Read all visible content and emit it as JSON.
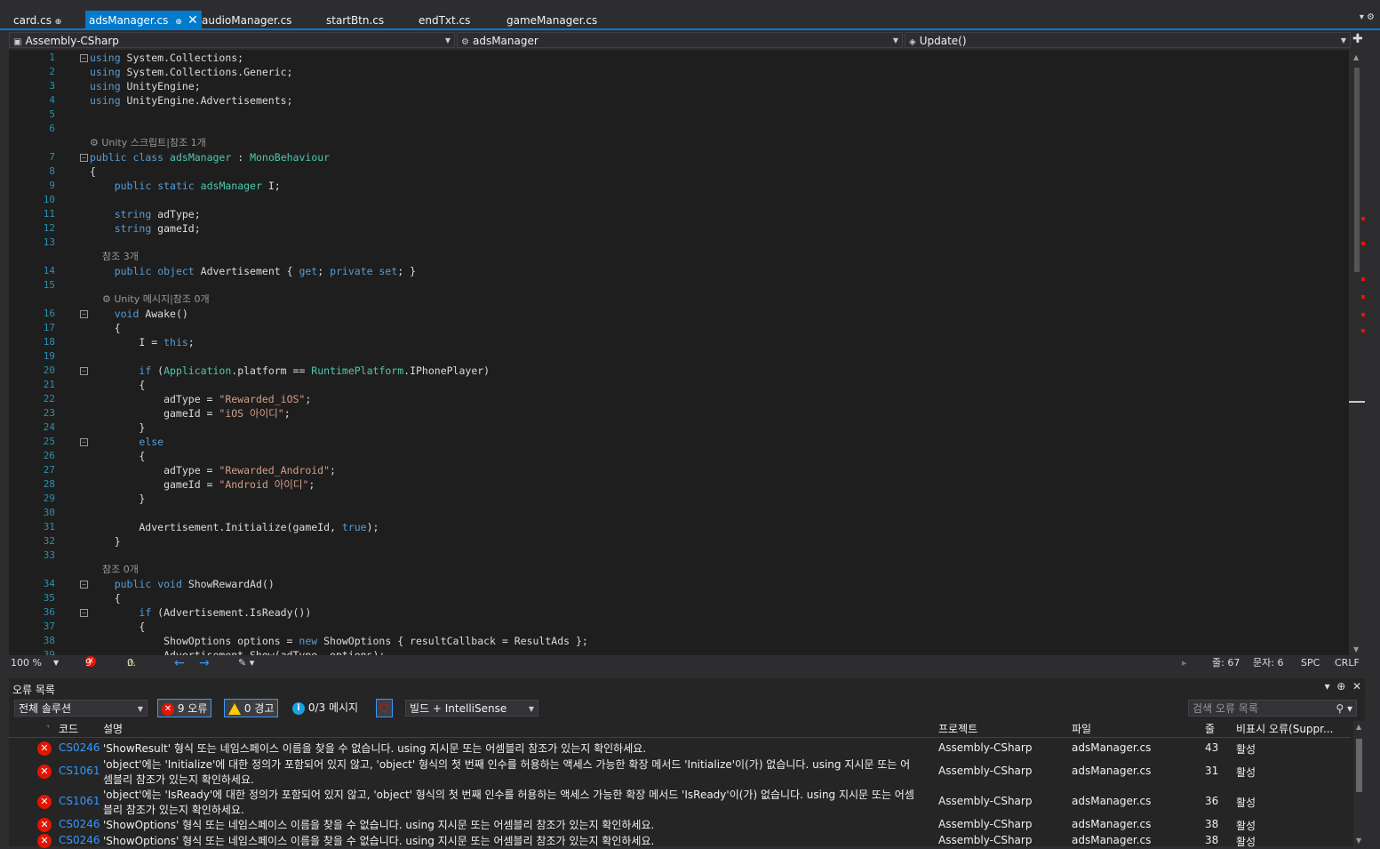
{
  "tabs": [
    {
      "label": "card.cs",
      "pin": "⊕"
    },
    {
      "label": "adsManager.cs",
      "pin": "⊕",
      "close": "✕",
      "active": true
    },
    {
      "label": "audioManager.cs"
    },
    {
      "label": "startBtn.cs"
    },
    {
      "label": "endTxt.cs"
    },
    {
      "label": "gameManager.cs"
    }
  ],
  "tab_overflow": "▾ ⚙",
  "nav": {
    "project": "Assembly-CSharp",
    "class": "adsManager",
    "member": "Update()"
  },
  "code": [
    {
      "n": "1",
      "t": "using System.Collections;"
    },
    {
      "n": "2",
      "t": "using System.Collections.Generic;"
    },
    {
      "n": "3",
      "t": "using UnityEngine;"
    },
    {
      "n": "4",
      "t": "using UnityEngine.Advertisements;"
    },
    {
      "n": "5",
      "t": ""
    },
    {
      "n": "6",
      "t": ""
    },
    {
      "lens": "⚙ Unity 스크립트|참조 1개"
    },
    {
      "n": "7",
      "t": "public class adsManager : MonoBehaviour"
    },
    {
      "n": "8",
      "t": "{"
    },
    {
      "n": "9",
      "t": "    public static adsManager I;"
    },
    {
      "n": "10",
      "t": ""
    },
    {
      "n": "11",
      "t": "    string adType;"
    },
    {
      "n": "12",
      "t": "    string gameId;"
    },
    {
      "n": "13",
      "t": ""
    },
    {
      "lens": "    참조 3개"
    },
    {
      "n": "14",
      "t": "    public object Advertisement { get; private set; }"
    },
    {
      "n": "15",
      "t": ""
    },
    {
      "lens": "    ⚙ Unity 메시지|참조 0개"
    },
    {
      "n": "16",
      "t": "    void Awake()"
    },
    {
      "n": "17",
      "t": "    {"
    },
    {
      "n": "18",
      "t": "        I = this;"
    },
    {
      "n": "19",
      "t": ""
    },
    {
      "n": "20",
      "t": "        if (Application.platform == RuntimePlatform.IPhonePlayer)"
    },
    {
      "n": "21",
      "t": "        {"
    },
    {
      "n": "22",
      "t": "            adType = \"Rewarded_iOS\";"
    },
    {
      "n": "23",
      "t": "            gameId = \"iOS 아이디\";"
    },
    {
      "n": "24",
      "t": "        }"
    },
    {
      "n": "25",
      "t": "        else"
    },
    {
      "n": "26",
      "t": "        {"
    },
    {
      "n": "27",
      "t": "            adType = \"Rewarded_Android\";"
    },
    {
      "n": "28",
      "t": "            gameId = \"Android 아이디\";"
    },
    {
      "n": "29",
      "t": "        }"
    },
    {
      "n": "30",
      "t": ""
    },
    {
      "n": "31",
      "t": "        Advertisement.Initialize(gameId, true);"
    },
    {
      "n": "32",
      "t": "    }"
    },
    {
      "n": "33",
      "t": ""
    },
    {
      "lens": "    참조 0개"
    },
    {
      "n": "34",
      "t": "    public void ShowRewardAd()"
    },
    {
      "n": "35",
      "t": "    {"
    },
    {
      "n": "36",
      "t": "        if (Advertisement.IsReady())"
    },
    {
      "n": "37",
      "t": "        {"
    },
    {
      "n": "38",
      "t": "            ShowOptions options = new ShowOptions { resultCallback = ResultAds };"
    },
    {
      "n": "39",
      "t": "            Advertisement.Show(adType, options);"
    }
  ],
  "status": {
    "zoom": "100 %",
    "errors": "9",
    "warnings": "0",
    "line": "줄: 67",
    "char": "문자: 6",
    "spc": "SPC",
    "crlf": "CRLF"
  },
  "errpanel": {
    "title": "오류 목록",
    "scope": "전체 솔루션",
    "errors_chip": "9 오류",
    "warnings_chip": "0 경고",
    "messages_chip": "0/3 메시지",
    "source": "빌드 + IntelliSense",
    "search_placeholder": "검색 오류 목록",
    "headers": {
      "code": "코드",
      "desc": "설명",
      "project": "프로젝트",
      "file": "파일",
      "line": "줄",
      "suppress": "비표시 오류(Suppr..."
    },
    "rows": [
      {
        "code": "CS0246",
        "desc": "'ShowResult' 형식 또는 네임스페이스 이름을 찾을 수 없습니다. using 지시문 또는 어셈블리 참조가 있는지 확인하세요.",
        "desc2": "",
        "project": "Assembly-CSharp",
        "file": "adsManager.cs",
        "line": "43",
        "state": "활성"
      },
      {
        "code": "CS1061",
        "desc": "'object'에는 'Initialize'에 대한 정의가 포함되어 있지 않고, 'object' 형식의 첫 번째 인수를 허용하는 액세스 가능한 확장 메서드 'Initialize'이(가) 없습니다. using 지시문 또는 어",
        "desc2": "셈블리 참조가 있는지 확인하세요.",
        "project": "Assembly-CSharp",
        "file": "adsManager.cs",
        "line": "31",
        "state": "활성"
      },
      {
        "code": "CS1061",
        "desc": "'object'에는 'IsReady'에 대한 정의가 포함되어 있지 않고, 'object' 형식의 첫 번째 인수를 허용하는 액세스 가능한 확장 메서드 'IsReady'이(가) 없습니다. using 지시문 또는 어셈",
        "desc2": "블리 참조가 있는지 확인하세요.",
        "project": "Assembly-CSharp",
        "file": "adsManager.cs",
        "line": "36",
        "state": "활성"
      },
      {
        "code": "CS0246",
        "desc": "'ShowOptions' 형식 또는 네임스페이스 이름을 찾을 수 없습니다. using 지시문 또는 어셈블리 참조가 있는지 확인하세요.",
        "desc2": "",
        "project": "Assembly-CSharp",
        "file": "adsManager.cs",
        "line": "38",
        "state": "활성"
      },
      {
        "code": "CS0246",
        "desc": "'ShowOptions' 형식 또는 네임스페이스 이름을 찾을 수 없습니다. using 지시문 또는 어셈블리 참조가 있는지 확인하세요.",
        "desc2": "",
        "project": "Assembly-CSharp",
        "file": "adsManager.cs",
        "line": "38",
        "state": "활성"
      }
    ]
  }
}
